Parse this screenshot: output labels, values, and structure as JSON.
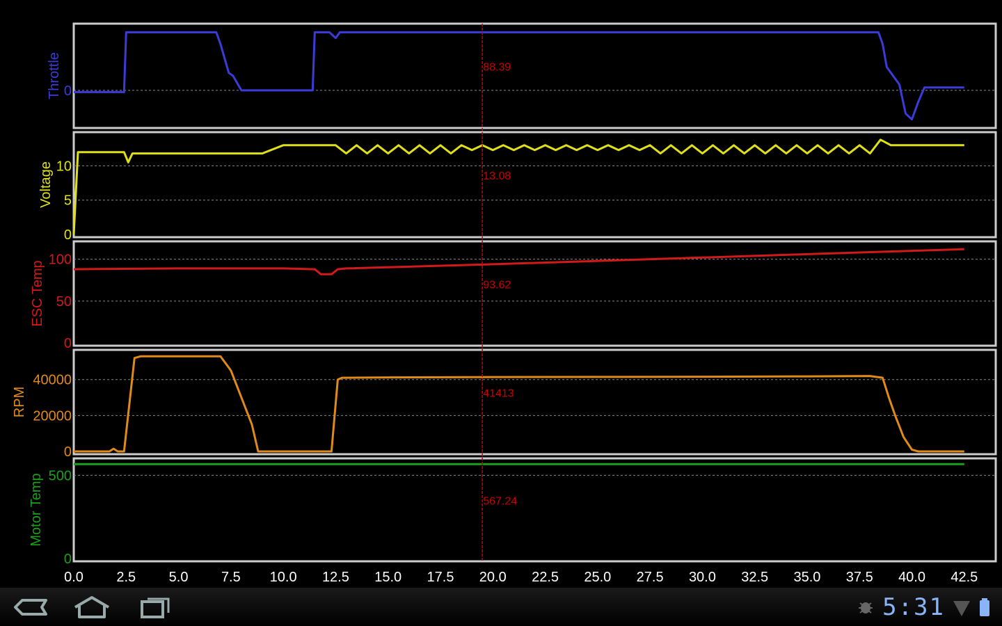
{
  "chart_data": [
    {
      "type": "line",
      "name": "Throttle",
      "ylabel": "Throttle",
      "color": "#3b3bd9",
      "yticks": [
        0
      ],
      "yticklabels": [
        "0"
      ],
      "ylim": [
        -60,
        110
      ],
      "cursor_value": "88.39",
      "x": [
        0,
        2.4,
        2.5,
        6.8,
        7.0,
        7.4,
        7.6,
        8.0,
        11.4,
        11.5,
        11.7,
        12.2,
        12.5,
        12.7,
        38.4,
        38.6,
        38.8,
        39.0,
        39.4,
        39.7,
        40.0,
        40.3,
        40.6,
        42.5
      ],
      "y": [
        -3,
        -3,
        100,
        100,
        80,
        30,
        25,
        0,
        0,
        100,
        100,
        100,
        90,
        100,
        100,
        80,
        40,
        30,
        10,
        -40,
        -50,
        -20,
        5,
        5
      ]
    },
    {
      "type": "line",
      "name": "Voltage",
      "ylabel": "Voltage",
      "color": "#e0e01a",
      "yticks": [
        0,
        5,
        10
      ],
      "yticklabels": [
        "0",
        "5",
        "10"
      ],
      "ylim": [
        0,
        14.5
      ],
      "cursor_value": "13.08",
      "x": [
        0,
        0.2,
        0.4,
        2.4,
        2.6,
        2.8,
        9,
        10,
        12.5,
        13,
        13.5,
        14,
        14.5,
        15,
        15.5,
        16,
        16.5,
        17,
        17.5,
        18,
        18.5,
        19,
        19.5,
        20,
        20.5,
        21,
        21.5,
        22,
        22.5,
        23,
        23.5,
        24,
        24.5,
        25,
        25.5,
        26,
        26.5,
        27,
        27.5,
        28,
        28.5,
        29,
        29.5,
        30,
        30.5,
        31,
        31.5,
        32,
        32.5,
        33,
        33.5,
        34,
        34.5,
        35,
        35.5,
        36,
        36.5,
        37,
        37.5,
        38,
        38.5,
        39,
        39.5,
        42.5
      ],
      "y": [
        0,
        12,
        12,
        12,
        10.5,
        11.8,
        11.8,
        13,
        13,
        11.8,
        13,
        11.8,
        13,
        11.8,
        13,
        11.8,
        13,
        11.8,
        13,
        11.8,
        13,
        12.3,
        13,
        12.3,
        13,
        12.3,
        13,
        12.3,
        13,
        12.3,
        13,
        12.3,
        13,
        12.3,
        13,
        12.3,
        13,
        12.3,
        13,
        11.8,
        13,
        11.8,
        13,
        11.8,
        13,
        11.8,
        13,
        11.8,
        13,
        11.8,
        13,
        11.8,
        13,
        11.8,
        13,
        11.8,
        13,
        11.8,
        13,
        11.8,
        13.8,
        13,
        13,
        13
      ]
    },
    {
      "type": "line",
      "name": "ESC Temp",
      "ylabel": "ESC Temp",
      "color": "#d11a1a",
      "yticks": [
        0,
        50,
        100
      ],
      "yticklabels": [
        "0",
        "50",
        "100"
      ],
      "ylim": [
        0,
        118
      ],
      "cursor_value": "93.62",
      "x": [
        0,
        5,
        10,
        11.5,
        11.8,
        12.3,
        12.6,
        13,
        19.5,
        25,
        30,
        35,
        40,
        42.5
      ],
      "y": [
        88,
        89,
        89,
        88,
        82,
        82,
        88,
        89,
        93.6,
        98,
        102,
        106,
        110,
        112
      ]
    },
    {
      "type": "line",
      "name": "RPM",
      "ylabel": "RPM",
      "color": "#e08a1a",
      "yticks": [
        0,
        20000,
        40000
      ],
      "yticklabels": [
        "0",
        "20000",
        "40000"
      ],
      "ylim": [
        0,
        55000
      ],
      "cursor_value": "41413",
      "x": [
        0,
        1.7,
        1.9,
        2.1,
        2.4,
        2.9,
        3.2,
        7.0,
        7.5,
        8.0,
        8.5,
        8.8,
        12.3,
        12.6,
        12.8,
        15,
        20,
        25,
        30,
        35,
        38,
        38.6,
        38.9,
        39.2,
        39.6,
        40.0,
        40.3,
        42.5
      ],
      "y": [
        0,
        0,
        1500,
        0,
        0,
        52000,
        53000,
        53000,
        45000,
        30000,
        15000,
        0,
        0,
        40000,
        41000,
        41200,
        41413,
        41500,
        41600,
        41800,
        42000,
        41000,
        30000,
        20000,
        8000,
        1000,
        0,
        0
      ]
    },
    {
      "type": "line",
      "name": "Motor Temp",
      "ylabel": "Motor Temp",
      "color": "#1aa01a",
      "yticks": [
        0,
        500
      ],
      "yticklabels": [
        "0",
        "500"
      ],
      "ylim": [
        0,
        585
      ],
      "cursor_value": "567.24",
      "x": [
        0,
        42.5
      ],
      "y": [
        567.24,
        567.24
      ]
    }
  ],
  "xaxis": {
    "xlim": [
      0,
      44
    ],
    "ticks": [
      0,
      2.5,
      5,
      7.5,
      10,
      12.5,
      15,
      17.5,
      20,
      22.5,
      25,
      27.5,
      30,
      32.5,
      35,
      37.5,
      40,
      42.5
    ],
    "ticklabels": [
      "0.0",
      "2.5",
      "5.0",
      "7.5",
      "10.0",
      "12.5",
      "15.0",
      "17.5",
      "20.0",
      "22.5",
      "25.0",
      "27.5",
      "30.0",
      "32.5",
      "35.0",
      "37.5",
      "40.0",
      "42.5"
    ],
    "cursor_x": 19.5
  },
  "colors": {
    "axis_tick": "#ffffff",
    "grid": "#888888",
    "cursor": "#cc0000",
    "frame": "#cccccc"
  },
  "status": {
    "clock": "5:31"
  },
  "icons": {
    "back": "back-icon",
    "home": "home-icon",
    "recent": "recent-apps-icon",
    "debug": "usb-debug-icon",
    "signal": "signal-icon",
    "battery": "battery-icon"
  }
}
